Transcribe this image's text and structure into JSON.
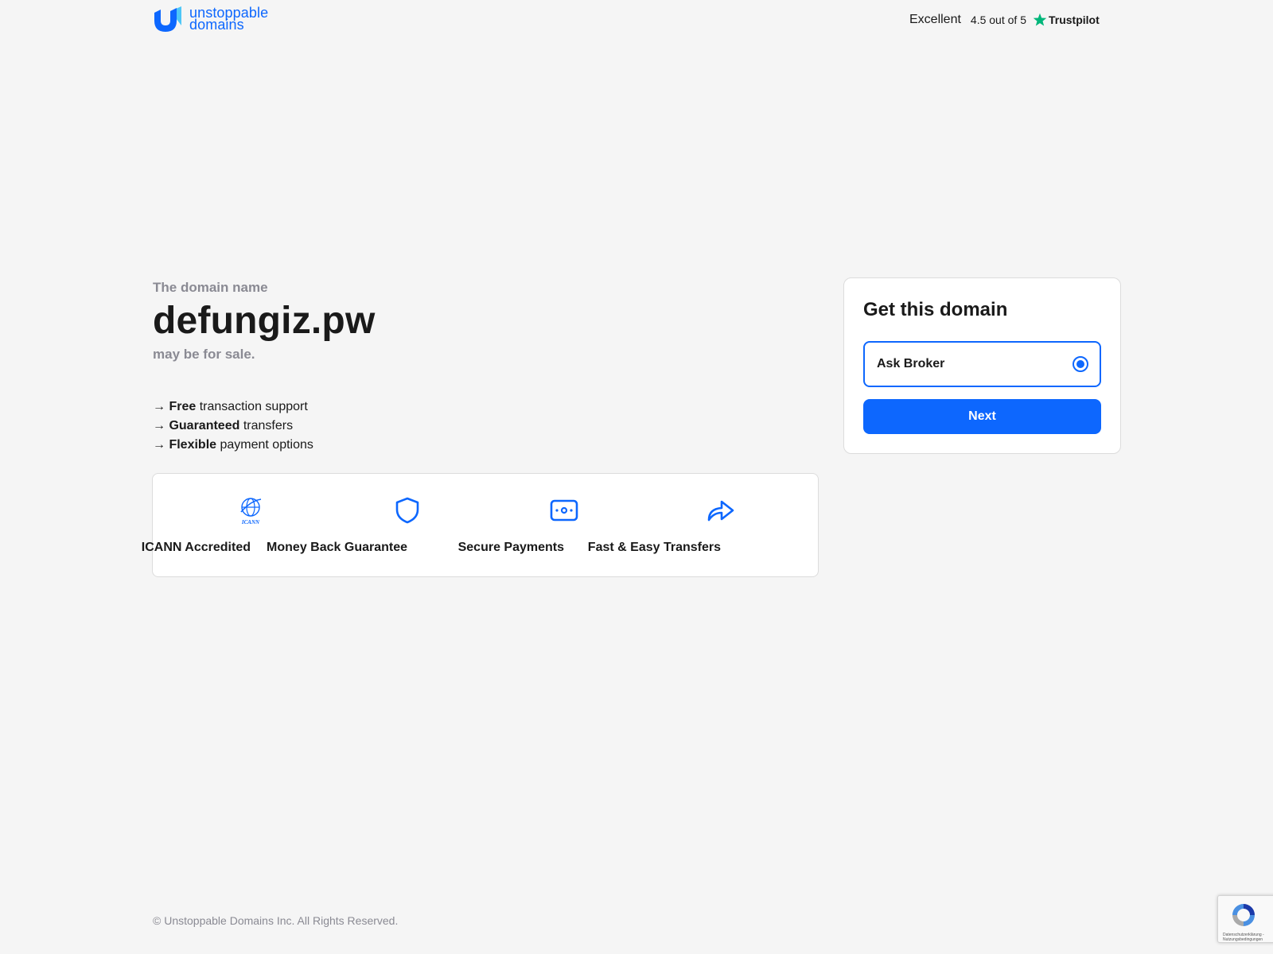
{
  "header": {
    "logo_line1": "unstoppable",
    "logo_line2": "domains",
    "trust_excellent": "Excellent",
    "trust_rating": "4.5 out of 5",
    "trust_brand": "Trustpilot"
  },
  "main": {
    "lede": "The domain name",
    "domain": "defungiz.pw",
    "sale_text": "may be for sale.",
    "features": [
      {
        "arrow": "→",
        "strong": "Free",
        "rest": "transaction support"
      },
      {
        "arrow": "→",
        "strong": "Guaranteed",
        "rest": "transfers"
      },
      {
        "arrow": "→",
        "strong": "Flexible",
        "rest": "payment options"
      }
    ]
  },
  "badges": [
    {
      "icon": "icann-globe-icon",
      "label": "ICANN Accredited",
      "icon_text": "ICANN"
    },
    {
      "icon": "shield-icon",
      "label": "Money Back Guarantee"
    },
    {
      "icon": "cash-icon",
      "label": "Secure Payments"
    },
    {
      "icon": "forward-arrow-icon",
      "label": "Fast & Easy Transfers"
    }
  ],
  "card": {
    "title": "Get this domain",
    "option_label": "Ask Broker",
    "option_selected": true,
    "next_label": "Next"
  },
  "footer": {
    "copyright": "© Unstoppable Domains Inc. All Rights Reserved."
  },
  "recaptcha": {
    "line1": "Datenschutzerklärung -",
    "line2": "Nutzungsbedingungen"
  },
  "colors": {
    "accent": "#0d67fe",
    "trustpilot_green": "#00b67a",
    "background": "#f5f5f5",
    "muted_text": "#8a8a93"
  }
}
